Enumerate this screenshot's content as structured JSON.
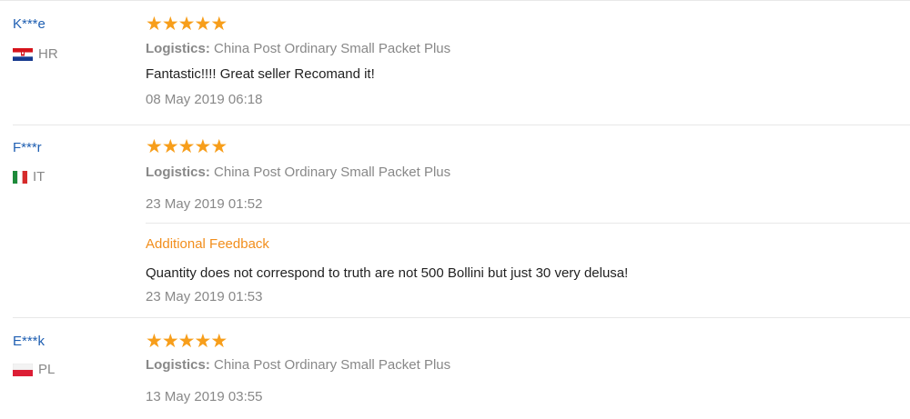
{
  "reviews": [
    {
      "user": "K***e",
      "country": "HR",
      "flag": "croatia-flag-icon",
      "logistics_label": "Logistics:",
      "logistics_value": "China Post Ordinary Small Packet Plus",
      "feedback": "Fantastic!!!! Great seller Recomand it!",
      "date": "08 May 2019 06:18"
    },
    {
      "user": "F***r",
      "country": "IT",
      "flag": "italy-flag-icon",
      "logistics_label": "Logistics:",
      "logistics_value": "China Post Ordinary Small Packet Plus",
      "feedback": "",
      "date": "23 May 2019 01:52",
      "additional": {
        "title": "Additional Feedback",
        "text": "Quantity does not correspond to truth are not 500 Bollini but just 30 very delusa!",
        "date": "23 May 2019 01:53"
      }
    },
    {
      "user": "E***k",
      "country": "PL",
      "flag": "poland-flag-icon",
      "logistics_label": "Logistics:",
      "logistics_value": "China Post Ordinary Small Packet Plus",
      "feedback": "",
      "date": "13 May 2019 03:55"
    }
  ],
  "rating_stars": 5,
  "colors": {
    "star": "#f79e1b",
    "username": "#1f5fb2",
    "additional_title": "#f28e1c"
  }
}
